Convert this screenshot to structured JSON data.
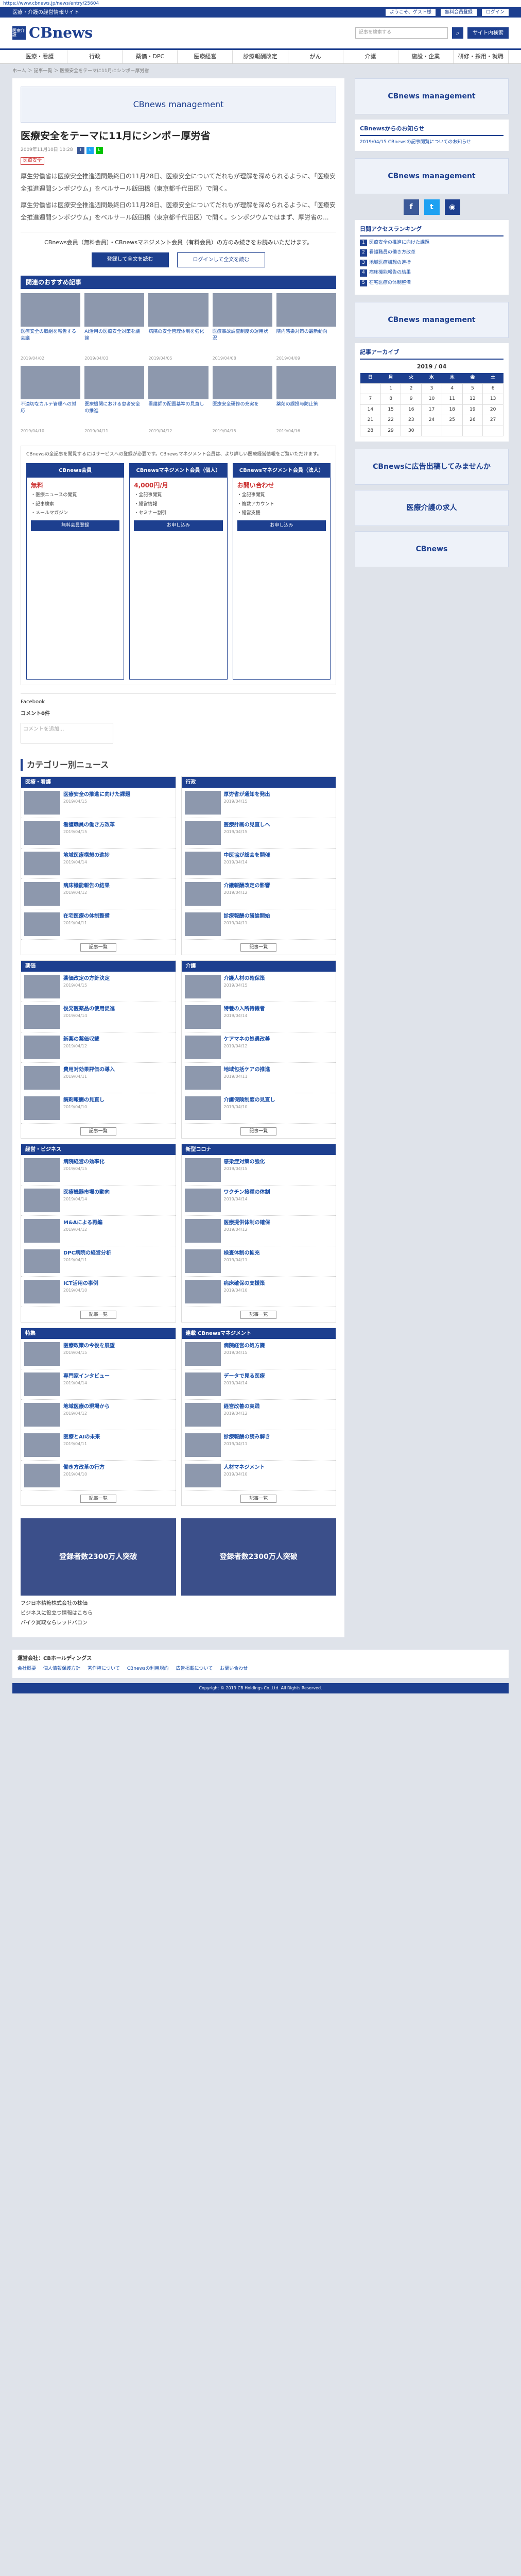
{
  "url": "https://www.cbnews.jp/news/entry/25604",
  "topbar": {
    "left": "医療・介護の経営情報サイト",
    "right": [
      "ようこそ、ゲスト様",
      "無料会員登録",
      "ログイン"
    ]
  },
  "header": {
    "logo_mark": "医療介護",
    "logo": "CBnews",
    "search_placeholder": "記事を検索する",
    "site_button": "サイト内検索"
  },
  "nav": [
    "医療・看護",
    "行政",
    "薬価・DPC",
    "医療経営",
    "診療報酬改定",
    "がん",
    "介護",
    "施設・企業",
    "研修・採用・就職"
  ],
  "breadcrumb": "ホーム ＞ 記事一覧 ＞ 医療安全をテーマに11月にシンポ－厚労省",
  "ad_top": "CBnews management",
  "article": {
    "title": "医療安全をテーマに11月にシンポ－厚労省",
    "date": "2009年11月10日 10:28",
    "tag": "医療安全",
    "paragraphs": [
      "厚生労働省は医療安全推進週間最終日の11月28日、医療安全についてだれもが理解を深められるように、「医療安全推進週間シンポジウム」をベルサール飯田橋（東京都千代田区）で開く。",
      "厚生労働省は医療安全推進週間最終日の11月28日、医療安全についてだれもが理解を深められるように、「医療安全推進週間シンポジウム」をベルサール飯田橋（東京都千代田区）で開く。シンポジウムではまず、厚労省の..."
    ]
  },
  "register": {
    "lead": "CBnews会員（無料会員）・CBnewsマネジメント会員（有料会員）の方のみ続きをお読みいただけます。",
    "btn1": "登録して全文を読む",
    "btn2": "ログインして全文を読む"
  },
  "rec": {
    "title": "関連のおすすめ記事",
    "items": [
      {
        "t": "医療安全の取組を報告する会議",
        "d": "2019/04/02"
      },
      {
        "t": "AI活用の医療安全対策を議論",
        "d": "2019/04/03"
      },
      {
        "t": "病院の安全管理体制を強化",
        "d": "2019/04/05"
      },
      {
        "t": "医療事故調査制度の運用状況",
        "d": "2019/04/08"
      },
      {
        "t": "院内感染対策の最新動向",
        "d": "2019/04/09"
      },
      {
        "t": "不適切なカルテ管理への対応",
        "d": "2019/04/10"
      },
      {
        "t": "医療機関における患者安全の推進",
        "d": "2019/04/11"
      },
      {
        "t": "看護師の配置基準の見直し",
        "d": "2019/04/12"
      },
      {
        "t": "医療安全研修の充実を",
        "d": "2019/04/15"
      },
      {
        "t": "薬剤の誤投与防止策",
        "d": "2019/04/16"
      }
    ]
  },
  "plans": {
    "note": "CBnewsの全記事を閲覧するにはサービスへの登録が必要です。CBnewsマネジメント会員は、より詳しい医療経営情報をご覧いただけます。",
    "cols": [
      {
        "h": "CBnews会員",
        "price": "無料",
        "rows": [
          "・医療ニュースの閲覧",
          "・記事検索",
          "・メールマガジン"
        ],
        "btn": "無料会員登録"
      },
      {
        "h": "CBnewsマネジメント会員（個人）",
        "price": "4,000円/月",
        "rows": [
          "・全記事閲覧",
          "・経営情報",
          "・セミナー割引"
        ],
        "btn": "お申し込み"
      },
      {
        "h": "CBnewsマネジメント会員（法人）",
        "price": "お問い合わせ",
        "rows": [
          "・全記事閲覧",
          "・複数アカウント",
          "・経営支援"
        ],
        "btn": "お申し込み"
      }
    ]
  },
  "fb": {
    "label": "Facebook",
    "comments": "コメント0件",
    "placeholder": "コメントを追加..."
  },
  "cat_title": "カテゴリー別ニュース",
  "categories": [
    {
      "h": "医療・看護",
      "items": [
        {
          "t": "医療安全の推進に向けた課題",
          "d": "2019/04/15"
        },
        {
          "t": "看護職員の働き方改革",
          "d": "2019/04/15"
        },
        {
          "t": "地域医療構想の進捗",
          "d": "2019/04/14"
        },
        {
          "t": "病床機能報告の結果",
          "d": "2019/04/12"
        },
        {
          "t": "在宅医療の体制整備",
          "d": "2019/04/11"
        }
      ]
    },
    {
      "h": "行政",
      "items": [
        {
          "t": "厚労省が通知を発出",
          "d": "2019/04/15"
        },
        {
          "t": "医療計画の見直しへ",
          "d": "2019/04/15"
        },
        {
          "t": "中医協が総会を開催",
          "d": "2019/04/14"
        },
        {
          "t": "介護報酬改定の影響",
          "d": "2019/04/12"
        },
        {
          "t": "診療報酬の議論開始",
          "d": "2019/04/11"
        }
      ]
    },
    {
      "h": "薬価",
      "items": [
        {
          "t": "薬価改定の方針決定",
          "d": "2019/04/15"
        },
        {
          "t": "後発医薬品の使用促進",
          "d": "2019/04/14"
        },
        {
          "t": "新薬の薬価収載",
          "d": "2019/04/12"
        },
        {
          "t": "費用対効果評価の導入",
          "d": "2019/04/11"
        },
        {
          "t": "調剤報酬の見直し",
          "d": "2019/04/10"
        }
      ]
    },
    {
      "h": "介護",
      "items": [
        {
          "t": "介護人材の確保策",
          "d": "2019/04/15"
        },
        {
          "t": "特養の入所待機者",
          "d": "2019/04/14"
        },
        {
          "t": "ケアマネの処遇改善",
          "d": "2019/04/12"
        },
        {
          "t": "地域包括ケアの推進",
          "d": "2019/04/11"
        },
        {
          "t": "介護保険制度の見直し",
          "d": "2019/04/10"
        }
      ]
    },
    {
      "h": "経営・ビジネス",
      "items": [
        {
          "t": "病院経営の効率化",
          "d": "2019/04/15"
        },
        {
          "t": "医療機器市場の動向",
          "d": "2019/04/14"
        },
        {
          "t": "M&Aによる再編",
          "d": "2019/04/12"
        },
        {
          "t": "DPC病院の経営分析",
          "d": "2019/04/11"
        },
        {
          "t": "ICT活用の事例",
          "d": "2019/04/10"
        }
      ]
    },
    {
      "h": "新型コロナ",
      "items": [
        {
          "t": "感染症対策の強化",
          "d": "2019/04/15"
        },
        {
          "t": "ワクチン接種の体制",
          "d": "2019/04/14"
        },
        {
          "t": "医療提供体制の確保",
          "d": "2019/04/12"
        },
        {
          "t": "検査体制の拡充",
          "d": "2019/04/11"
        },
        {
          "t": "病床確保の支援策",
          "d": "2019/04/10"
        }
      ]
    },
    {
      "h": "特集",
      "items": [
        {
          "t": "医療政策の今後を展望",
          "d": "2019/04/15"
        },
        {
          "t": "専門家インタビュー",
          "d": "2019/04/14"
        },
        {
          "t": "地域医療の現場から",
          "d": "2019/04/12"
        },
        {
          "t": "医療とAIの未来",
          "d": "2019/04/11"
        },
        {
          "t": "働き方改革の行方",
          "d": "2019/04/10"
        }
      ]
    },
    {
      "h": "連載 CBnewsマネジメント",
      "items": [
        {
          "t": "病院経営の処方箋",
          "d": "2019/04/15"
        },
        {
          "t": "データで見る医療",
          "d": "2019/04/14"
        },
        {
          "t": "経営改善の実践",
          "d": "2019/04/12"
        },
        {
          "t": "診療報酬の読み解き",
          "d": "2019/04/11"
        },
        {
          "t": "人材マネジメント",
          "d": "2019/04/10"
        }
      ]
    }
  ],
  "more_label": "記事一覧",
  "ads_bottom": [
    "登録者数2300万人突破",
    "登録者数2300万人突破"
  ],
  "text_ads": [
    "フジ日本精糖株式会社の株価",
    "ビジネスに役立つ情報はこちら",
    "バイク買取ならレッドバロン"
  ],
  "side": {
    "ad1": "CBnews management",
    "cbtitle": "CBnewsからのお知らせ",
    "cbnews": [
      "2019/04/15 CBnewsの記事閲覧についてのお知らせ"
    ],
    "ad2": "CBnews management",
    "rank_title": "日間アクセスランキング",
    "rank": [
      "医療安全の推進に向けた課題",
      "看護職員の働き方改革",
      "地域医療構想の進捗",
      "病床機能報告の結果",
      "在宅医療の体制整備"
    ],
    "ad3": "CBnews management",
    "cal_title": "記事アーカイブ",
    "cal_month": "2019 / 04",
    "week": [
      "日",
      "月",
      "火",
      "水",
      "木",
      "金",
      "土"
    ],
    "ad4": "CBnewsに広告出稿してみませんか",
    "ad5": "医療介護の求人",
    "ad6": "CBnews"
  },
  "footer": {
    "h": "運営会社：CBホールディングス",
    "links": [
      "会社概要",
      "個人情報保護方針",
      "著作権について",
      "CBnewsの利用規約",
      "広告掲載について",
      "お問い合わせ"
    ],
    "copy": "Copyright © 2019 CB Holdings Co.,Ltd. All Rights Reserved."
  }
}
